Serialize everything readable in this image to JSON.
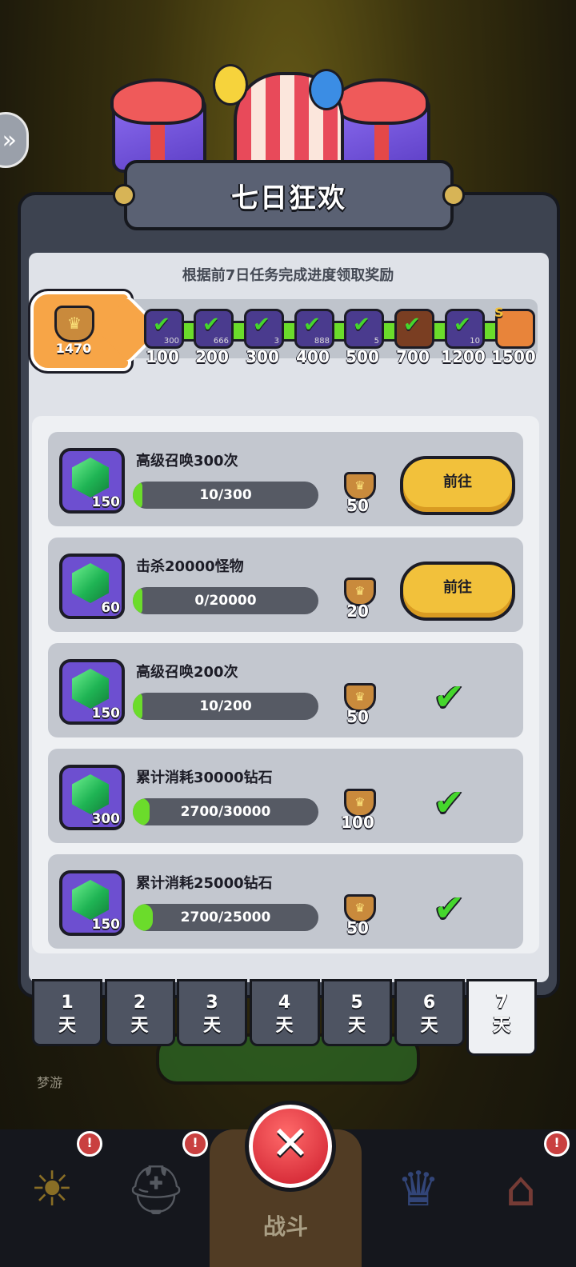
{
  "header": {
    "title": "七日狂欢",
    "subtitle": "根据前7日任务完成进度领取奖励"
  },
  "progress": {
    "current_score": "1470",
    "milestones": [
      {
        "value": "100",
        "small": "300",
        "claimed": true
      },
      {
        "value": "200",
        "small": "666",
        "claimed": true
      },
      {
        "value": "300",
        "small": "3",
        "claimed": true
      },
      {
        "value": "400",
        "small": "888",
        "claimed": true
      },
      {
        "value": "500",
        "small": "5",
        "claimed": true
      },
      {
        "value": "700",
        "small": "",
        "claimed": true
      },
      {
        "value": "1200",
        "small": "10",
        "claimed": true
      },
      {
        "value": "1500",
        "small": "",
        "claimed": false
      }
    ],
    "final_reward_tag": "S"
  },
  "tasks": [
    {
      "title": "高级召唤300次",
      "gem_count": "150",
      "progress_text": "10/300",
      "progress_fraction": 0.033,
      "medal_points": "50",
      "action_label": "前往",
      "completed": false
    },
    {
      "title": "击杀20000怪物",
      "gem_count": "60",
      "progress_text": "0/20000",
      "progress_fraction": 0.0,
      "medal_points": "20",
      "action_label": "前往",
      "completed": false
    },
    {
      "title": "高级召唤200次",
      "gem_count": "150",
      "progress_text": "10/200",
      "progress_fraction": 0.05,
      "medal_points": "50",
      "action_label": "",
      "completed": true
    },
    {
      "title": "累计消耗30000钻石",
      "gem_count": "300",
      "progress_text": "2700/30000",
      "progress_fraction": 0.09,
      "medal_points": "100",
      "action_label": "",
      "completed": true
    },
    {
      "title": "累计消耗25000钻石",
      "gem_count": "150",
      "progress_text": "2700/25000",
      "progress_fraction": 0.108,
      "medal_points": "50",
      "action_label": "",
      "completed": true
    }
  ],
  "day_tabs": [
    {
      "num": "1",
      "unit": "天",
      "active": false
    },
    {
      "num": "2",
      "unit": "天",
      "active": false
    },
    {
      "num": "3",
      "unit": "天",
      "active": false
    },
    {
      "num": "4",
      "unit": "天",
      "active": false
    },
    {
      "num": "5",
      "unit": "天",
      "active": false
    },
    {
      "num": "6",
      "unit": "天",
      "active": false
    },
    {
      "num": "7",
      "unit": "天",
      "active": true
    }
  ],
  "background": {
    "sleep_label": "梦游"
  },
  "bottom_nav": {
    "battle_label": "战斗",
    "badge_symbol": "!"
  },
  "icons": {
    "check": "check-icon",
    "close": "close-icon",
    "gem": "emerald-gem-icon",
    "medal": "crown-medal-icon"
  },
  "colors": {
    "accent_green": "#6bdc2b",
    "button_yellow": "#f2c13b",
    "close_red": "#d82e3a"
  }
}
